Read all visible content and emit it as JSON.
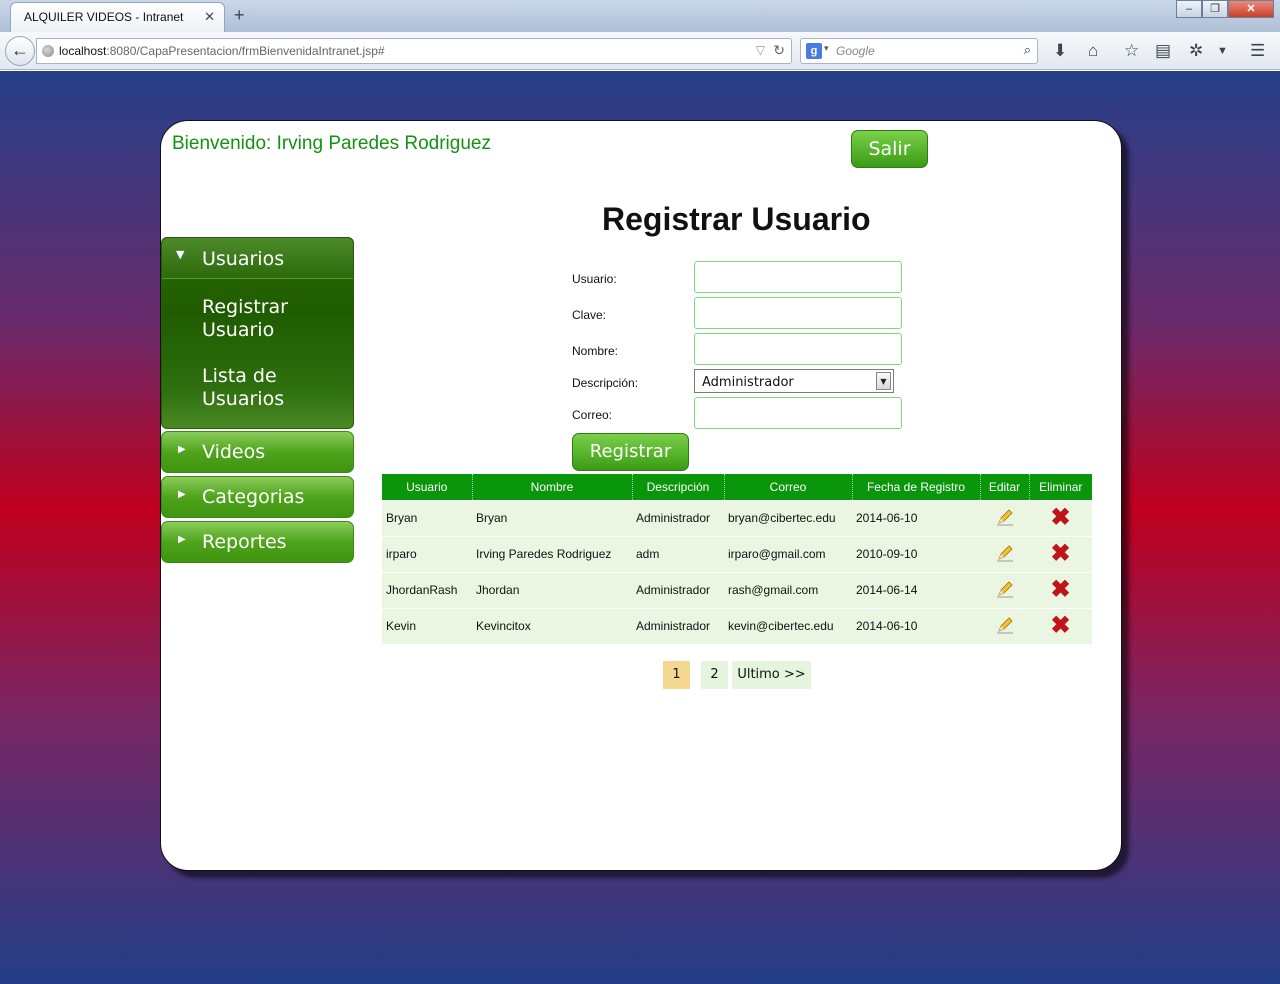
{
  "browser": {
    "tab_title": "ALQUILER VIDEOS - Intranet",
    "url_host": "localhost",
    "url_rest": ":8080/CapaPresentacion/frmBienvenidaIntranet.jsp#",
    "search_placeholder": "Google"
  },
  "header": {
    "welcome": "Bienvenido: Irving Paredes Rodriguez",
    "logout_label": "Salir"
  },
  "sidebar": {
    "open_section": {
      "label": "Usuarios",
      "items": [
        "Registrar Usuario",
        "Lista de Usuarios"
      ]
    },
    "sections": [
      "Videos",
      "Categorias",
      "Reportes"
    ]
  },
  "form": {
    "title": "Registrar Usuario",
    "usuario_label": "Usuario:",
    "clave_label": "Clave:",
    "nombre_label": "Nombre:",
    "descripcion_label": "Descripción:",
    "descripcion_value": "Administrador",
    "correo_label": "Correo:",
    "submit_label": "Registrar"
  },
  "table": {
    "headers": [
      "Usuario",
      "Nombre",
      "Descripción",
      "Correo",
      "Fecha de Registro",
      "Editar",
      "Eliminar"
    ],
    "rows": [
      [
        "Bryan",
        "Bryan",
        "Administrador",
        "bryan@cibertec.edu",
        "2014-06-10"
      ],
      [
        "irparo",
        "Irving Paredes Rodriguez",
        "adm",
        "irparo@gmail.com",
        "2010-09-10"
      ],
      [
        "JhordanRash",
        "Jhordan",
        "Administrador",
        "rash@gmail.com",
        "2014-06-14"
      ],
      [
        "Kevin",
        "Kevincitox",
        "Administrador",
        "kevin@cibertec.edu",
        "2014-06-10"
      ]
    ]
  },
  "pagination": {
    "pages": [
      "1",
      "2"
    ],
    "active": "1",
    "last_label": "Ultimo >>"
  },
  "colors": {
    "accent_green": "#0a960a",
    "welcome_green": "#139213",
    "delete_red": "#c0141a"
  }
}
